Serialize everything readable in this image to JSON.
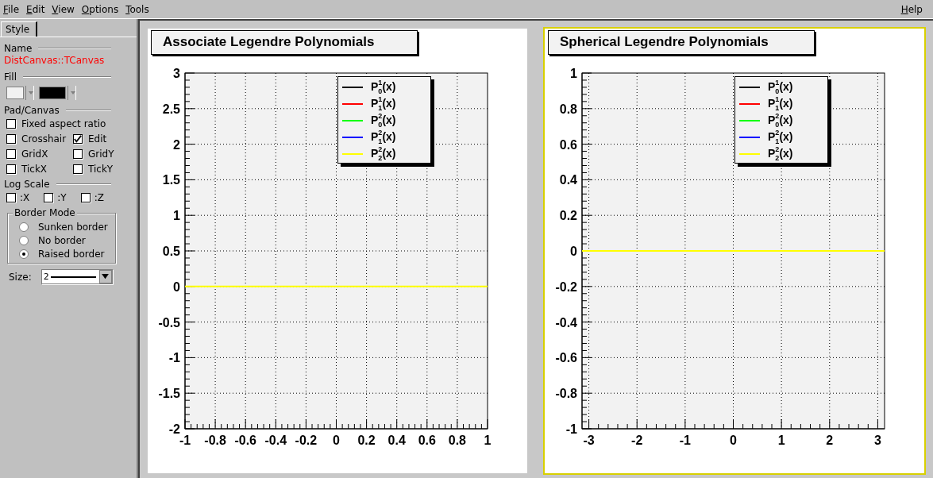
{
  "menu": {
    "items": [
      {
        "label": "File"
      },
      {
        "label": "Edit"
      },
      {
        "label": "View"
      },
      {
        "label": "Options"
      },
      {
        "label": "Tools"
      }
    ],
    "help": {
      "label": "Help"
    }
  },
  "editor": {
    "tabs": [
      {
        "label": "Style",
        "selected": true
      }
    ],
    "name_heading": "Name",
    "name_value": "DistCanvas::TCanvas",
    "fill_heading": "Fill",
    "fill_colors": [
      {
        "color": "#f2f2f2"
      },
      {
        "color": "#000000"
      }
    ],
    "pad_heading": "Pad/Canvas",
    "pad_options": [
      [
        {
          "label": "Fixed aspect ratio",
          "checked": false
        }
      ],
      [
        {
          "label": "Crosshair",
          "checked": false
        },
        {
          "label": "Edit",
          "checked": true
        }
      ],
      [
        {
          "label": "GridX",
          "checked": false
        },
        {
          "label": "GridY",
          "checked": false
        }
      ],
      [
        {
          "label": "TickX",
          "checked": false
        },
        {
          "label": "TickY",
          "checked": false
        }
      ]
    ],
    "log_heading": "Log Scale",
    "log_options": [
      {
        "label": ":X",
        "checked": false
      },
      {
        "label": ":Y",
        "checked": false
      },
      {
        "label": ":Z",
        "checked": false
      }
    ],
    "border_mode": {
      "title": "Border Mode",
      "options": [
        {
          "label": "Sunken border",
          "selected": false
        },
        {
          "label": "No border",
          "selected": false
        },
        {
          "label": "Raised border",
          "selected": true
        }
      ]
    },
    "size": {
      "label": "Size:",
      "value": "2"
    }
  },
  "pads": [
    {
      "title": "Associate Legendre Polynomials",
      "selected": false,
      "legend": [
        {
          "label": "P$^{1}$$_{0}$(x)",
          "color": "#000000"
        },
        {
          "label": "P$^{1}$$_{1}$(x)",
          "color": "#ff0000"
        },
        {
          "label": "P$^{2}$$_{0}$(x)",
          "color": "#00ff00"
        },
        {
          "label": "P$^{2}$$_{1}$(x)",
          "color": "#0000ff"
        },
        {
          "label": "P$^{2}$$_{2}$(x)",
          "color": "#ffff00"
        }
      ],
      "chart_data": {
        "type": "line",
        "grid": true,
        "x": [
          -1,
          1
        ],
        "xlim": [
          -1,
          1
        ],
        "ylim": [
          -2,
          3
        ],
        "xticks": [
          -1,
          -0.8,
          -0.6,
          -0.4,
          -0.2,
          0,
          0.2,
          0.4,
          0.6,
          0.8,
          1
        ],
        "yticks": [
          -2,
          -1.5,
          -1,
          -0.5,
          0,
          0.5,
          1,
          1.5,
          2,
          2.5,
          3
        ],
        "series": [
          {
            "color": "#ffff00",
            "values": [
              0,
              0
            ]
          }
        ]
      }
    },
    {
      "title": "Spherical Legendre Polynomials",
      "selected": true,
      "legend": [
        {
          "label": "P$^{1}$$_{0}$(x)",
          "color": "#000000"
        },
        {
          "label": "P$^{1}$$_{1}$(x)",
          "color": "#ff0000"
        },
        {
          "label": "P$^{2}$$_{0}$(x)",
          "color": "#00ff00"
        },
        {
          "label": "P$^{2}$$_{1}$(x)",
          "color": "#0000ff"
        },
        {
          "label": "P$^{2}$$_{2}$(x)",
          "color": "#ffff00"
        }
      ],
      "chart_data": {
        "type": "line",
        "grid": true,
        "x": [
          -3.1416,
          3.1416
        ],
        "xlim": [
          -3.1416,
          3.1416
        ],
        "ylim": [
          -1,
          1
        ],
        "xticks": [
          -3,
          -2,
          -1,
          0,
          1,
          2,
          3
        ],
        "yticks": [
          -1,
          -0.8,
          -0.6,
          -0.4,
          -0.2,
          0,
          0.2,
          0.4,
          0.6,
          0.8,
          1
        ],
        "series": [
          {
            "color": "#ffff00",
            "values": [
              0,
              0
            ]
          }
        ]
      }
    }
  ]
}
